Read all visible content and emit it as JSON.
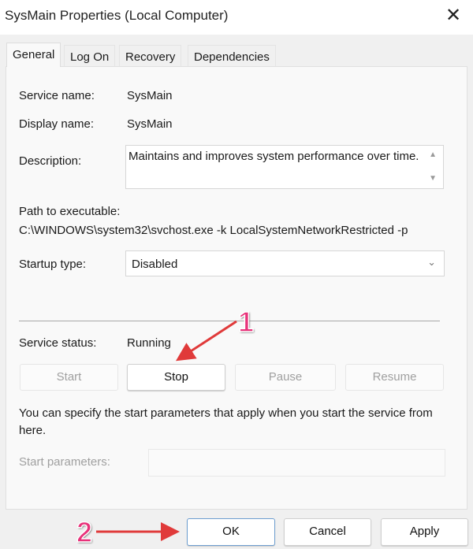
{
  "window": {
    "title": "SysMain Properties (Local Computer)",
    "close_icon": "close-icon"
  },
  "tabs": [
    {
      "label": "General",
      "active": true
    },
    {
      "label": "Log On"
    },
    {
      "label": "Recovery"
    },
    {
      "label": "Dependencies"
    }
  ],
  "general": {
    "service_name_label": "Service name:",
    "service_name": "SysMain",
    "display_name_label": "Display name:",
    "display_name": "SysMain",
    "description_label": "Description:",
    "description": "Maintains and improves system performance over time.",
    "path_label": "Path to executable:",
    "path": "C:\\WINDOWS\\system32\\svchost.exe -k LocalSystemNetworkRestricted -p",
    "startup_label": "Startup type:",
    "startup_value": "Disabled",
    "status_label": "Service status:",
    "status_value": "Running",
    "buttons": {
      "start": "Start",
      "stop": "Stop",
      "pause": "Pause",
      "resume": "Resume"
    },
    "hint": "You can specify the start parameters that apply when you start the service from here.",
    "params_label": "Start parameters:",
    "params_value": ""
  },
  "footer": {
    "ok": "OK",
    "cancel": "Cancel",
    "apply": "Apply"
  },
  "annotations": {
    "step1": "1",
    "step2": "2",
    "arrow_color": "#e03a3a",
    "number_color": "#e8327a"
  }
}
